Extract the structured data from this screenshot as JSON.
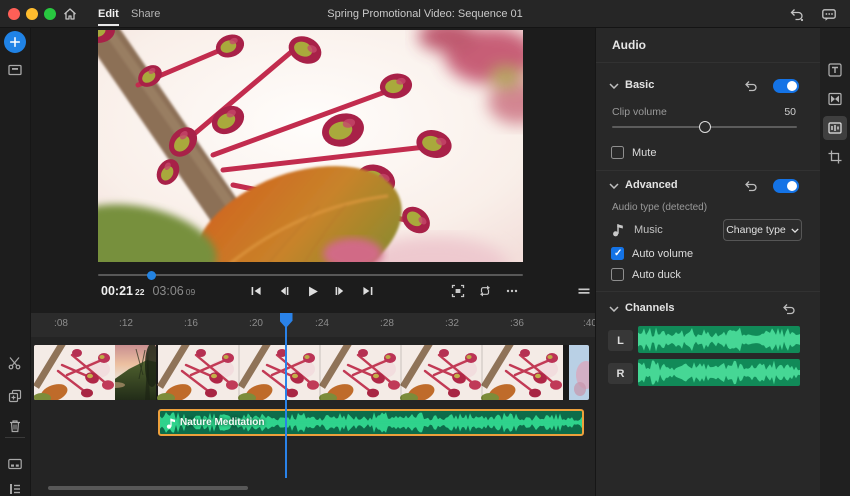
{
  "titlebar": {
    "tabs": [
      {
        "label": "Edit"
      },
      {
        "label": "Share"
      }
    ],
    "title": "Spring Promotional Video: Sequence 01"
  },
  "transport": {
    "current_time": "00:21",
    "current_frames": "22",
    "duration_time": "03:06",
    "duration_frames": "09"
  },
  "timeline": {
    "ruler_ticks": [
      ":08",
      ":12",
      ":16",
      ":20",
      ":24",
      ":28",
      ":32",
      ":36",
      ":40"
    ],
    "audio_clip_label": "Nature Meditation"
  },
  "audio_panel": {
    "title": "Audio",
    "basic_label": "Basic",
    "basic_enabled": true,
    "clip_volume_label": "Clip volume",
    "clip_volume_value": "50",
    "mute_label": "Mute",
    "mute_checked": false,
    "advanced_label": "Advanced",
    "advanced_enabled": true,
    "audio_type_label": "Audio type (detected)",
    "audio_type_value": "Music",
    "change_type_label": "Change type",
    "auto_volume_label": "Auto volume",
    "auto_volume_checked": true,
    "auto_duck_label": "Auto duck",
    "auto_duck_checked": false,
    "channels_label": "Channels",
    "channel_left": "L",
    "channel_right": "R"
  },
  "icons": {
    "home": "house",
    "undo": "curved-arrow-left",
    "feedback": "speech-bubble",
    "add_media": "plus-circle",
    "media_bin": "storage-box",
    "split": "scissors",
    "duplicate": "stacked-squares-plus",
    "delete": "trash-can",
    "track_options": "card-with-dots",
    "track_list": "list-lines",
    "titles": "boxed-T",
    "transitions": "bowtie-box",
    "color": "overlapping-circles",
    "audio": "waveform-box",
    "crop_transform": "crop-corners",
    "music": "eighth-note",
    "reset": "undo-arrow",
    "fullscreen": "bracket-frame",
    "loop": "repeat-arrows",
    "more": "ellipsis",
    "timeline_menu": "double-lines"
  },
  "colors": {
    "accent_blue": "#1473e6",
    "playhead_blue": "#2a82e8",
    "clip_selection_orange": "#eda03c",
    "waveform_green": "#3bd38f",
    "waveform_bg_green": "#11865a",
    "traffic_red": "#ff5f57",
    "traffic_yellow": "#febc2e",
    "traffic_green": "#28c840"
  }
}
